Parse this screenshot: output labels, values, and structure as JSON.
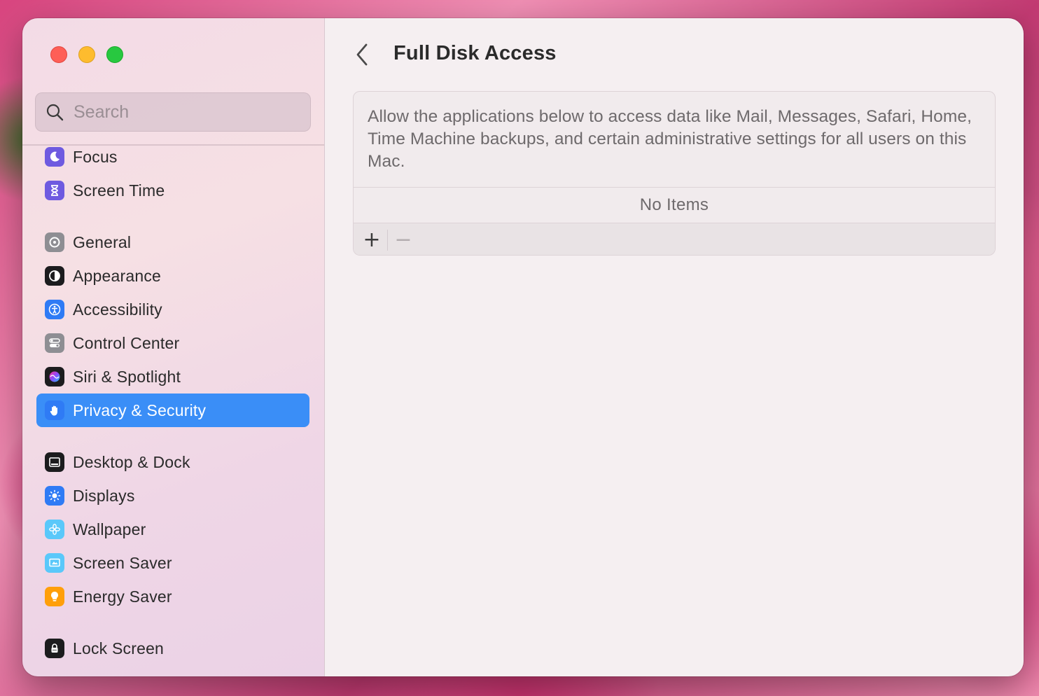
{
  "window": {
    "title": "Full Disk Access"
  },
  "sidebar": {
    "search_placeholder": "Search",
    "items": [
      {
        "label": "Focus",
        "icon": "moon-icon",
        "color": "#6e5ae0"
      },
      {
        "label": "Screen Time",
        "icon": "hourglass-icon",
        "color": "#6e5ae0"
      },
      {
        "label": "General",
        "icon": "gear-icon",
        "color": "#8e8e93"
      },
      {
        "label": "Appearance",
        "icon": "appearance-icon",
        "color": "#1c1c1e"
      },
      {
        "label": "Accessibility",
        "icon": "accessibility-icon",
        "color": "#2f7bf5"
      },
      {
        "label": "Control Center",
        "icon": "toggles-icon",
        "color": "#8e8e93"
      },
      {
        "label": "Siri & Spotlight",
        "icon": "siri-icon",
        "color": "#1c1c1e"
      },
      {
        "label": "Privacy & Security",
        "icon": "hand-icon",
        "color": "#2f7bf5",
        "active": true
      },
      {
        "label": "Desktop & Dock",
        "icon": "dock-icon",
        "color": "#1c1c1e"
      },
      {
        "label": "Displays",
        "icon": "sun-icon",
        "color": "#2f7bf5"
      },
      {
        "label": "Wallpaper",
        "icon": "flower-icon",
        "color": "#5ac8fa"
      },
      {
        "label": "Screen Saver",
        "icon": "screensaver-icon",
        "color": "#5ac8fa"
      },
      {
        "label": "Energy Saver",
        "icon": "bulb-icon",
        "color": "#ff9f0a"
      },
      {
        "label": "Lock Screen",
        "icon": "lock-icon",
        "color": "#1c1c1e"
      }
    ]
  },
  "main": {
    "back_icon": "chevron-left-icon",
    "title": "Full Disk Access",
    "description": "Allow the applications below to access data like Mail, Messages, Safari, Home, Time Machine backups, and certain administrative settings for all users on this Mac.",
    "empty_text": "No Items",
    "add_label": "+",
    "remove_label": "−"
  },
  "colors": {
    "accent": "#3a8ef7"
  }
}
